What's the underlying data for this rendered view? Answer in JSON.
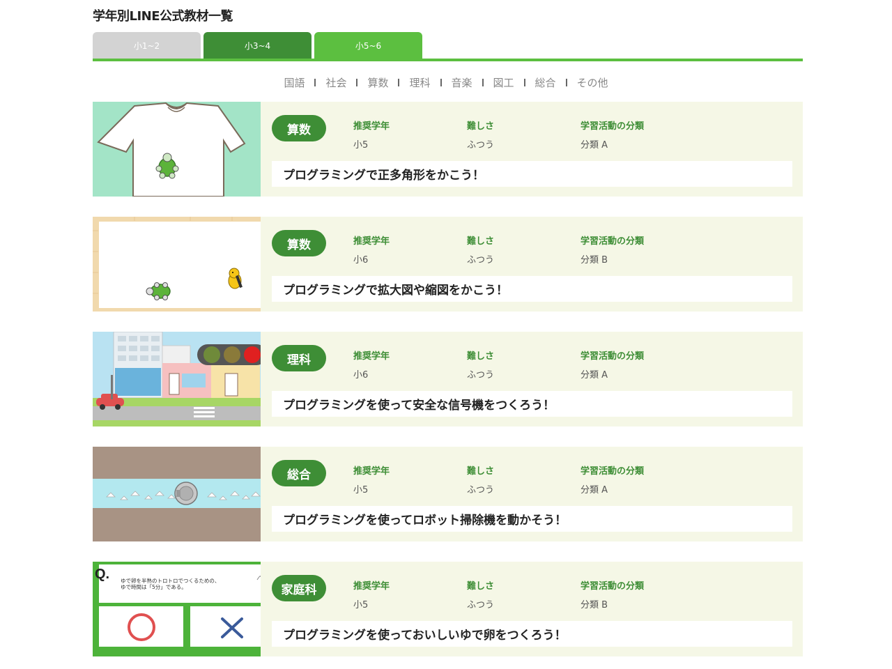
{
  "page": {
    "title": "学年別LINE公式教材一覧"
  },
  "tabs": [
    {
      "label": "小1~2"
    },
    {
      "label": "小3~4"
    },
    {
      "label": "小5~6"
    }
  ],
  "subjects": [
    "国語",
    "社会",
    "算数",
    "理科",
    "音楽",
    "図工",
    "総合",
    "その他"
  ],
  "labels": {
    "grade": "推奨学年",
    "difficulty": "難しさ",
    "category": "学習活動の分類"
  },
  "cards": [
    {
      "subject": "算数",
      "grade": "小5",
      "difficulty": "ふつう",
      "category": "分類 A",
      "title": "プログラミングで正多角形をかこう！",
      "thumb": "tshirt-turtle-image"
    },
    {
      "subject": "算数",
      "grade": "小6",
      "difficulty": "ふつう",
      "category": "分類 B",
      "title": "プログラミングで拡大図や縮図をかこう！",
      "thumb": "turtle-and-duck-image"
    },
    {
      "subject": "理科",
      "grade": "小6",
      "difficulty": "ふつう",
      "category": "分類 A",
      "title": "プログラミングを使って安全な信号機をつくろう！",
      "thumb": "traffic-light-street-image"
    },
    {
      "subject": "総合",
      "grade": "小5",
      "difficulty": "ふつう",
      "category": "分類 A",
      "title": "プログラミングを使ってロボット掃除機を動かそう！",
      "thumb": "robot-vacuum-image"
    },
    {
      "subject": "家庭科",
      "grade": "小5",
      "difficulty": "ふつう",
      "category": "分類 B",
      "title": "プログラミングを使っておいしいゆで卵をつくろう！",
      "thumb": "egg-quiz-image"
    }
  ],
  "quiz": {
    "mark": "Q.",
    "text_line1": "ゆで卵を半熟のトロトロでつくるための、",
    "text_line2": "ゆで時間は「5分」である。"
  },
  "colors": {
    "primary_green": "#3e8e36",
    "light_green": "#5cbf40",
    "card_bg": "#f5f7e6",
    "tab_inactive": "#d3d3d3"
  }
}
